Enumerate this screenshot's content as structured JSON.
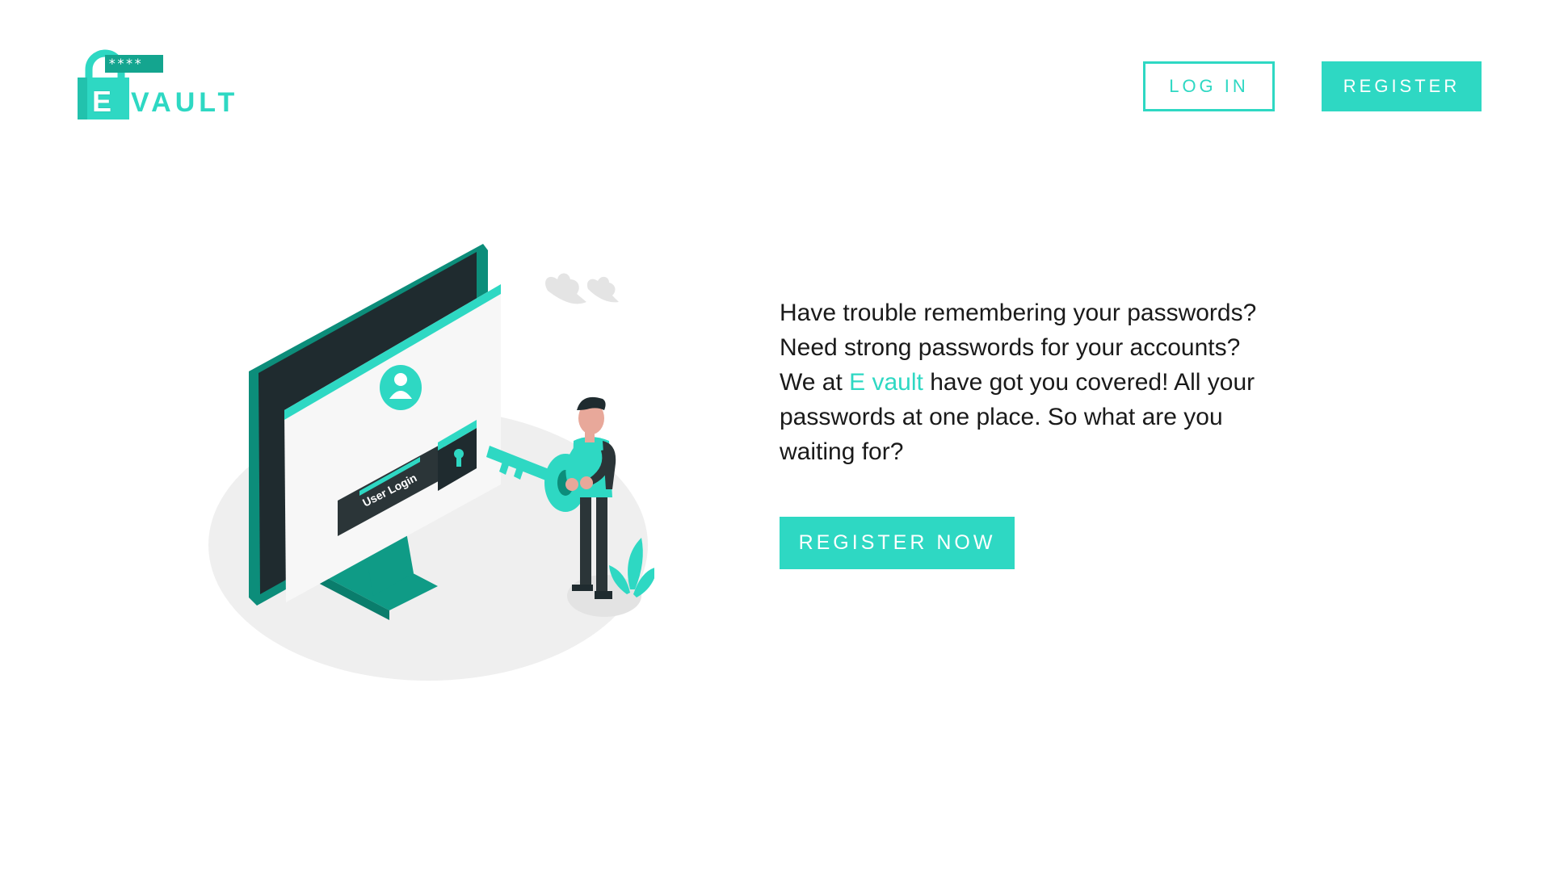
{
  "brand": {
    "logo_letter": "E",
    "logo_word": "VAULT",
    "logo_stars": "****",
    "accent_color": "#2ed8c3",
    "dark_accent_color": "#0c8d7a"
  },
  "header": {
    "login_label": "LOG IN",
    "register_label": "REGISTER"
  },
  "hero": {
    "text_before": "Have trouble remembering your passwords? Need strong passwords for your accounts? We at ",
    "text_highlight": "E vault",
    "text_after": " have got you covered! All your passwords at one place. So what are you waiting for?",
    "cta_label": "REGISTER NOW",
    "illustration_screen_label": "User Login"
  }
}
